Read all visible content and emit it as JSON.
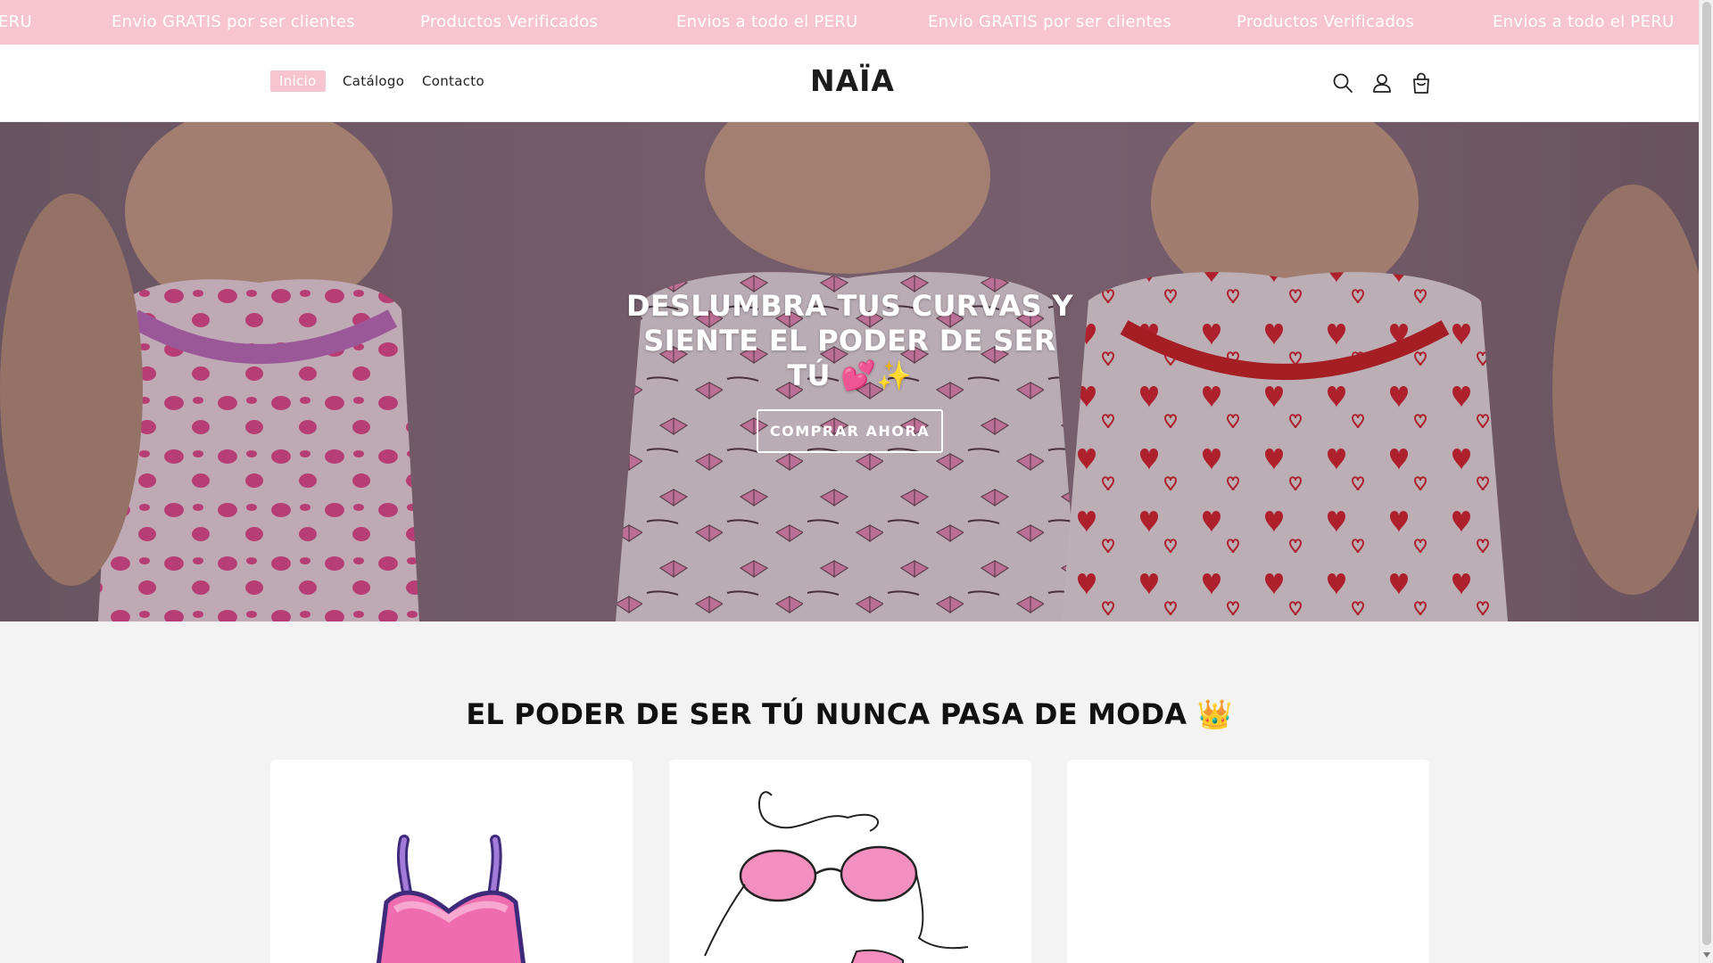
{
  "announcement": {
    "items": [
      "ERU",
      "Envio GRATIS por ser clientes",
      "Productos Verificados",
      "Envios a todo el PERU",
      "Envio GRATIS por ser clientes",
      "Productos Verificados",
      "Envios a todo el PERU"
    ]
  },
  "header": {
    "nav": [
      "Inicio",
      "Catálogo",
      "Contacto"
    ],
    "logo": "NAÏA",
    "icons": [
      "search-icon",
      "account-icon",
      "cart-icon"
    ]
  },
  "hero": {
    "title": "DESLUMBRA TUS CURVAS Y SIENTE EL PODER DE SER TÚ 💕✨",
    "button": "COMPRAR AHORA"
  },
  "collection": {
    "title": "EL PODER DE SER TÚ NUNCA PASA DE MODA 👑",
    "cards": [
      {
        "image": "pink-camisole-illustration"
      },
      {
        "image": "pink-bra-illustration"
      },
      {
        "image": "blank"
      }
    ]
  },
  "colors": {
    "announcement_bg": "#f7c5cf",
    "accent_pink": "#f7c5cf",
    "page_bg": "#f3f3f3"
  }
}
